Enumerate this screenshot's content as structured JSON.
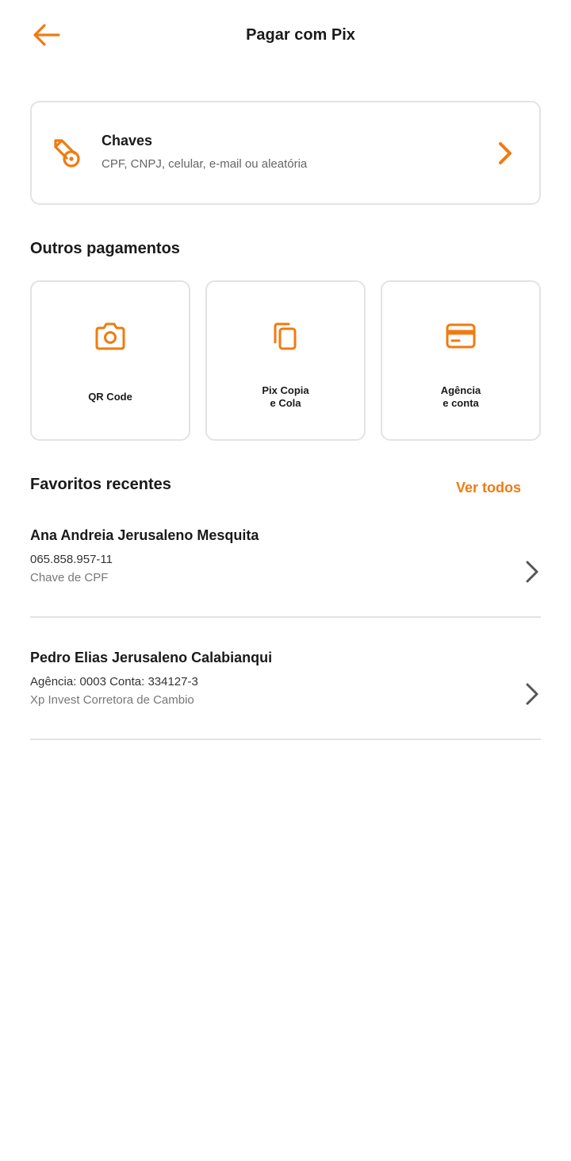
{
  "header": {
    "title": "Pagar com Pix",
    "back_icon": "arrow-left-icon"
  },
  "keys_card": {
    "title": "Chaves",
    "subtitle": "CPF, CNPJ, celular, e-mail ou aleatória",
    "icon": "key-icon",
    "chevron_icon": "chevron-right-icon"
  },
  "other_payments": {
    "title": "Outros pagamentos",
    "tiles": [
      {
        "label": "QR Code",
        "icon": "camera-icon"
      },
      {
        "label": "Pix Copia\ne Cola",
        "icon": "copy-icon"
      },
      {
        "label": "Agência\ne conta",
        "icon": "card-icon"
      }
    ]
  },
  "favorites": {
    "title": "Favoritos recentes",
    "see_all_label": "Ver todos",
    "items": [
      {
        "name": "Ana Andreia Jerusaleno Mesquita",
        "line1": "065.858.957-11",
        "line2": "Chave de CPF"
      },
      {
        "name": "Pedro Elias Jerusaleno Calabianqui",
        "line1": "Agência: 0003 Conta: 334127-3",
        "line2": "Xp Invest Corretora de Cambio"
      }
    ]
  },
  "colors": {
    "accent": "#f07b10",
    "border": "#e3e3e3",
    "text": "#1a1a1a",
    "muted": "#666666"
  }
}
